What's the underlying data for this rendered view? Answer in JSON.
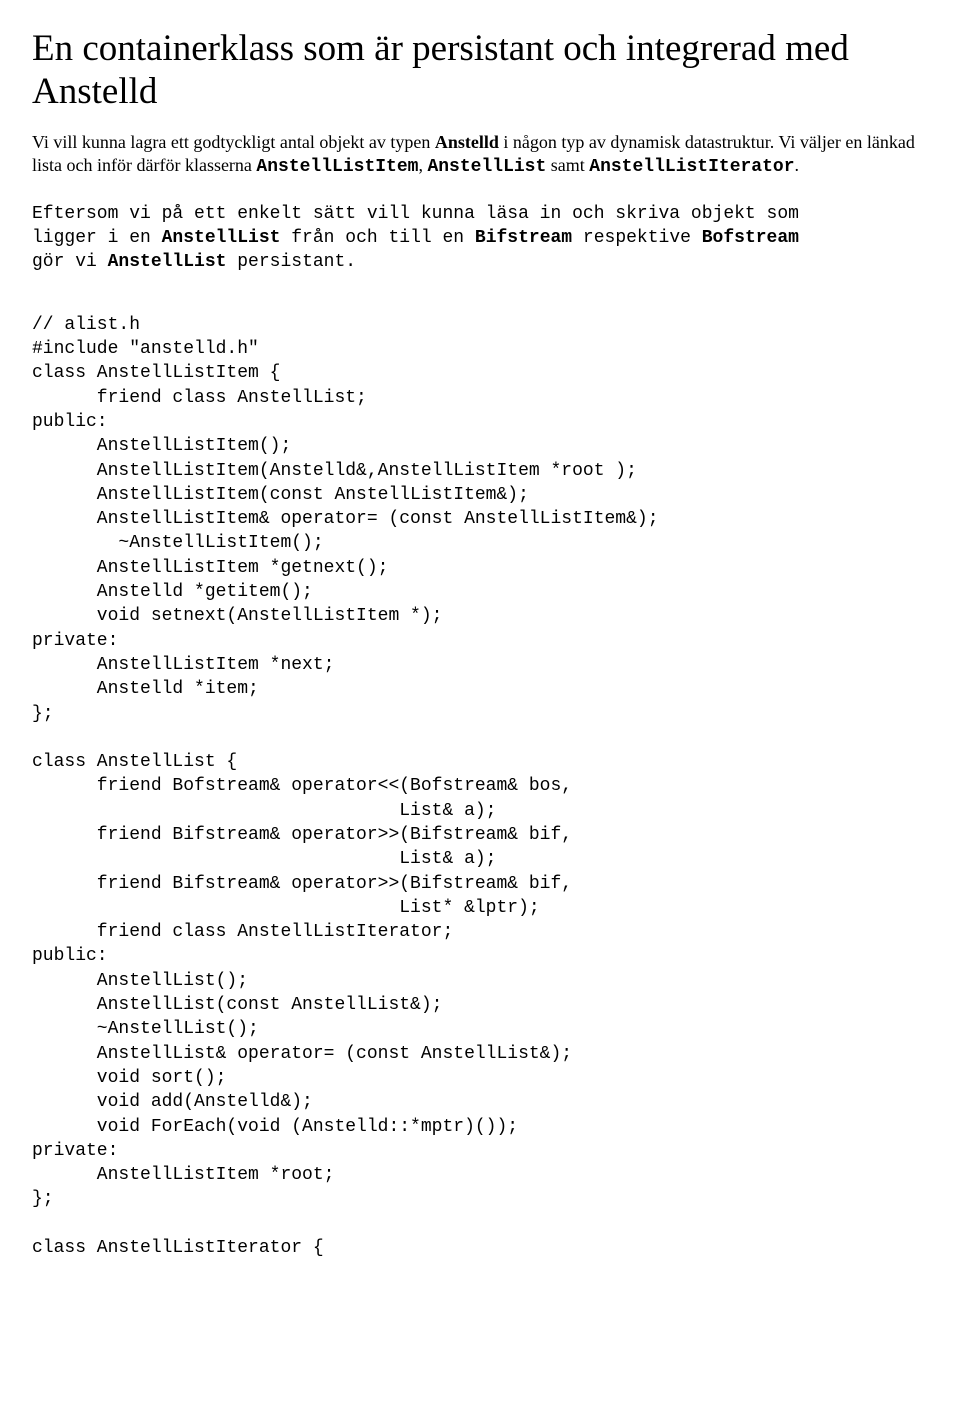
{
  "title": "En containerklass som är persistant och integrerad med Anstelld",
  "intro": {
    "part1": "Vi vill kunna lagra ett godtyckligt antal objekt av typen ",
    "bold1": "Anstelld",
    "part2": " i någon typ av dynamisk datastruktur. Vi väljer en länkad lista och inför därför klasserna ",
    "mono1": "AnstellListItem",
    "part3": ", ",
    "mono2": "AnstellList",
    "part4": " samt ",
    "mono3": "AnstellListIterator",
    "part5": "."
  },
  "rationale": {
    "p1": "Eftersom vi på ett enkelt sätt vill kunna läsa in och skriva objekt som",
    "p2a": "ligger i en ",
    "b1": "AnstellList",
    "p2b": " från och till en ",
    "b2": "Bifstream",
    "p2c": " respektive ",
    "b3": "Bofstream",
    "p3a": "gör vi ",
    "b4": "AnstellList",
    "p3b": " persistant."
  },
  "code": "// alist.h\n#include \"anstelld.h\"\nclass AnstellListItem {\n      friend class AnstellList;\npublic:\n      AnstellListItem();\n      AnstellListItem(Anstelld&,AnstellListItem *root );\n      AnstellListItem(const AnstellListItem&);\n      AnstellListItem& operator= (const AnstellListItem&);\n        ~AnstellListItem();\n      AnstellListItem *getnext();\n      Anstelld *getitem();\n      void setnext(AnstellListItem *);\nprivate:\n      AnstellListItem *next;\n      Anstelld *item;\n};\n\nclass AnstellList {\n      friend Bofstream& operator<<(Bofstream& bos,\n                                  List& a);\n      friend Bifstream& operator>>(Bifstream& bif,\n                                  List& a);\n      friend Bifstream& operator>>(Bifstream& bif,\n                                  List* &lptr);\n      friend class AnstellListIterator;\npublic:\n      AnstellList();\n      AnstellList(const AnstellList&);\n      ~AnstellList();\n      AnstellList& operator= (const AnstellList&);\n      void sort();\n      void add(Anstelld&);\n      void ForEach(void (Anstelld::*mptr)());\nprivate:\n      AnstellListItem *root;\n};\n\nclass AnstellListIterator {"
}
